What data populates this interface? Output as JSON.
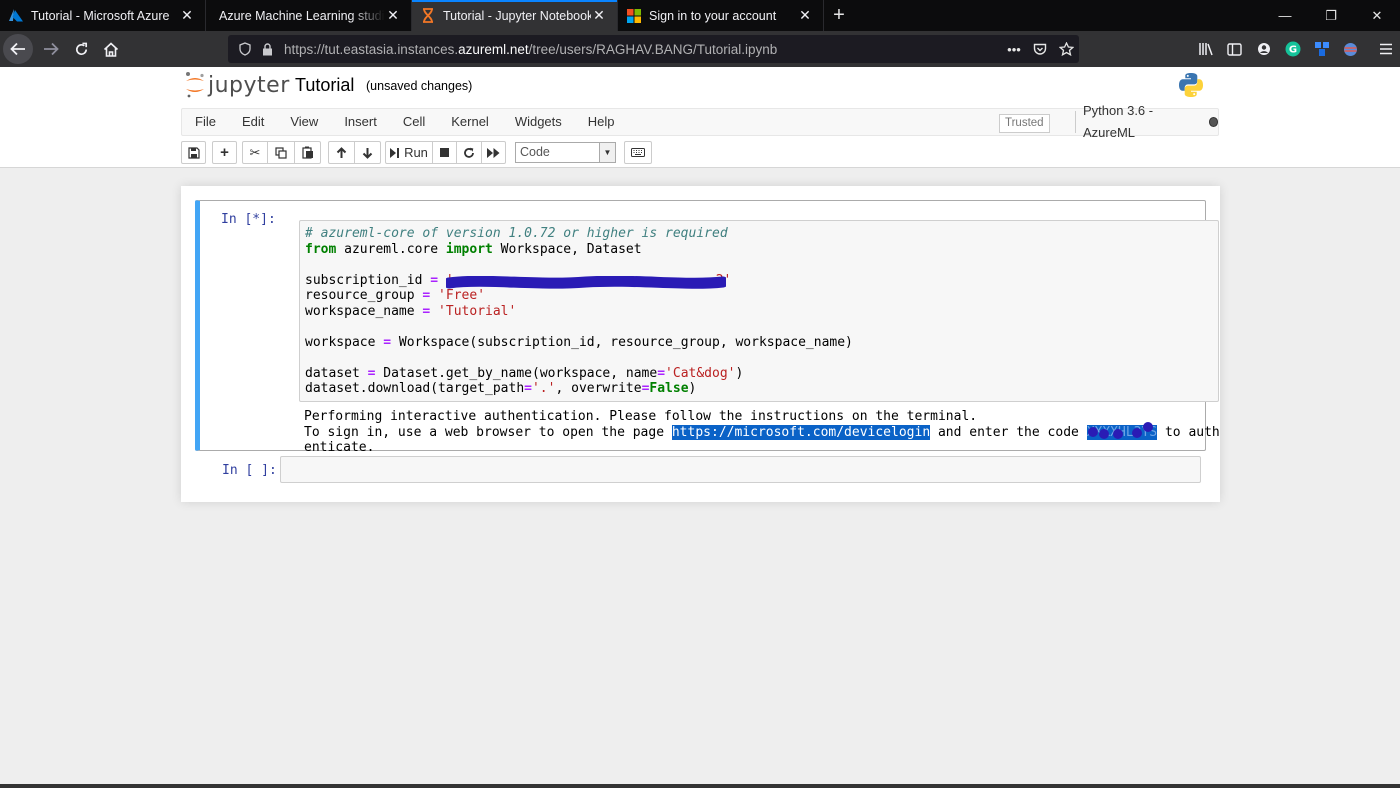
{
  "browser": {
    "tabs": [
      {
        "title": "Tutorial - Microsoft Azure",
        "icon": "azure-icon",
        "active": false
      },
      {
        "title": "Azure Machine Learning studio (Pre",
        "icon": "none",
        "active": false
      },
      {
        "title": "Tutorial - Jupyter Notebook",
        "icon": "hourglass-icon",
        "active": true
      },
      {
        "title": "Sign in to your account",
        "icon": "microsoft-icon",
        "active": false
      }
    ],
    "new_tab": "+",
    "url_prefix": "https://tut.eastasia.instances.",
    "url_domain": "azureml.net",
    "url_path": "/tree/users/RAGHAV.BANG/Tutorial.ipynb",
    "page_actions": "•••"
  },
  "jupyter": {
    "logo_text": "jupyter",
    "notebook_name": "Tutorial",
    "save_status": "(unsaved changes)",
    "menu": [
      "File",
      "Edit",
      "View",
      "Insert",
      "Cell",
      "Kernel",
      "Widgets",
      "Help"
    ],
    "trusted": "Trusted",
    "kernel_name": "Python 3.6 - AzureML",
    "toolbar": {
      "run_label": "Run",
      "cell_type": "Code"
    }
  },
  "cells": {
    "cell1_prompt": "In [*]:",
    "cell2_prompt": "In [ ]:",
    "code": {
      "l1": "# azureml-core of version 1.0.72 or higher is required",
      "l2_kw1": "from",
      "l2_mod": " azureml.core ",
      "l2_kw2": "import",
      "l2_rest": " Workspace, Dataset",
      "l4_var": "subscription_id ",
      "l4_eq": "=",
      "l4_str_start": " '",
      "l4_str_end": "2'",
      "l5_var": "resource_group ",
      "l5_eq": "=",
      "l5_str": " 'Free'",
      "l6_var": "workspace_name ",
      "l6_eq": "=",
      "l6_str": " 'Tutorial'",
      "l8_var": "workspace ",
      "l8_eq": "=",
      "l8_rest": " Workspace(subscription_id, resource_group, workspace_name)",
      "l10_var": "dataset ",
      "l10_eq": "=",
      "l10_mid": " Dataset.get_by_name(workspace, name",
      "l10_eq2": "=",
      "l10_str": "'Cat&dog'",
      "l10_end": ")",
      "l11_a": "dataset.download(target_path",
      "l11_eq": "=",
      "l11_str": "'.'",
      "l11_b": ", overwrite",
      "l11_eq2": "=",
      "l11_kw": "False",
      "l11_end": ")"
    },
    "output": {
      "line1": "Performing interactive authentication. Please follow the instructions on the terminal.",
      "line2_a": "To sign in, use a web browser to open the page ",
      "link": "https://microsoft.com/devicelogin",
      "line2_b": " and enter the code ",
      "code_redacted": "XXXXHL3YS",
      "line2_c": " to auth",
      "line3": "enticate."
    }
  },
  "colors": {
    "selected_cell_border": "#42a5f5",
    "prompt": "#303f9f",
    "comment": "#408080",
    "keyword": "#008000",
    "string": "#ba2121",
    "redaction": "#2a1bb5",
    "selection": "#0a62c7"
  }
}
